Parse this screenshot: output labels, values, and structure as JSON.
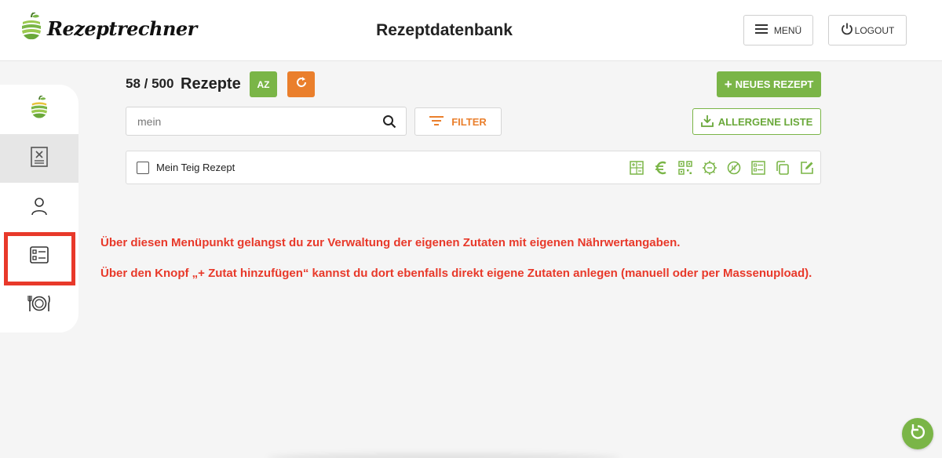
{
  "brand": {
    "name": "Rezeptrechner",
    "accent": "#7ab547",
    "orange": "#ea7f2c",
    "annotation": "#e8392a"
  },
  "header": {
    "title": "Rezeptdatenbank",
    "menu_label": "MENÜ",
    "logout_label": "LOGOUT"
  },
  "sidebar": {
    "items": [
      {
        "name": "apple-logo-icon"
      },
      {
        "name": "recipe-book-icon",
        "active": true
      },
      {
        "name": "user-icon"
      },
      {
        "name": "ingredients-list-icon",
        "highlighted": true
      },
      {
        "name": "plate-cutlery-icon"
      }
    ]
  },
  "toolbar": {
    "count": "58 / 500",
    "count_label": "Rezepte",
    "sort_label": "AZ",
    "new_recipe_label": "NEUES REZEPT",
    "filter_label": "FILTER",
    "allergen_label": "ALLERGENE LISTE"
  },
  "search": {
    "value": "mein",
    "placeholder": ""
  },
  "recipes": [
    {
      "name": "Mein Teig Rezept",
      "actions": [
        "calculator-icon",
        "euro-icon",
        "qr-code-icon",
        "badge-icon",
        "no-sign-icon",
        "checklist-icon",
        "copy-icon",
        "edit-icon"
      ]
    }
  ],
  "annotations": {
    "line1": "Über diesen Menüpunkt gelangst du zur Verwaltung der eigenen Zutaten mit eigenen Nährwertangaben.",
    "line2": "Über den Knopf „+ Zutat hinzufügen“ kannst du dort ebenfalls direkt eigene Zutaten anlegen (manuell oder per Massenupload)."
  }
}
